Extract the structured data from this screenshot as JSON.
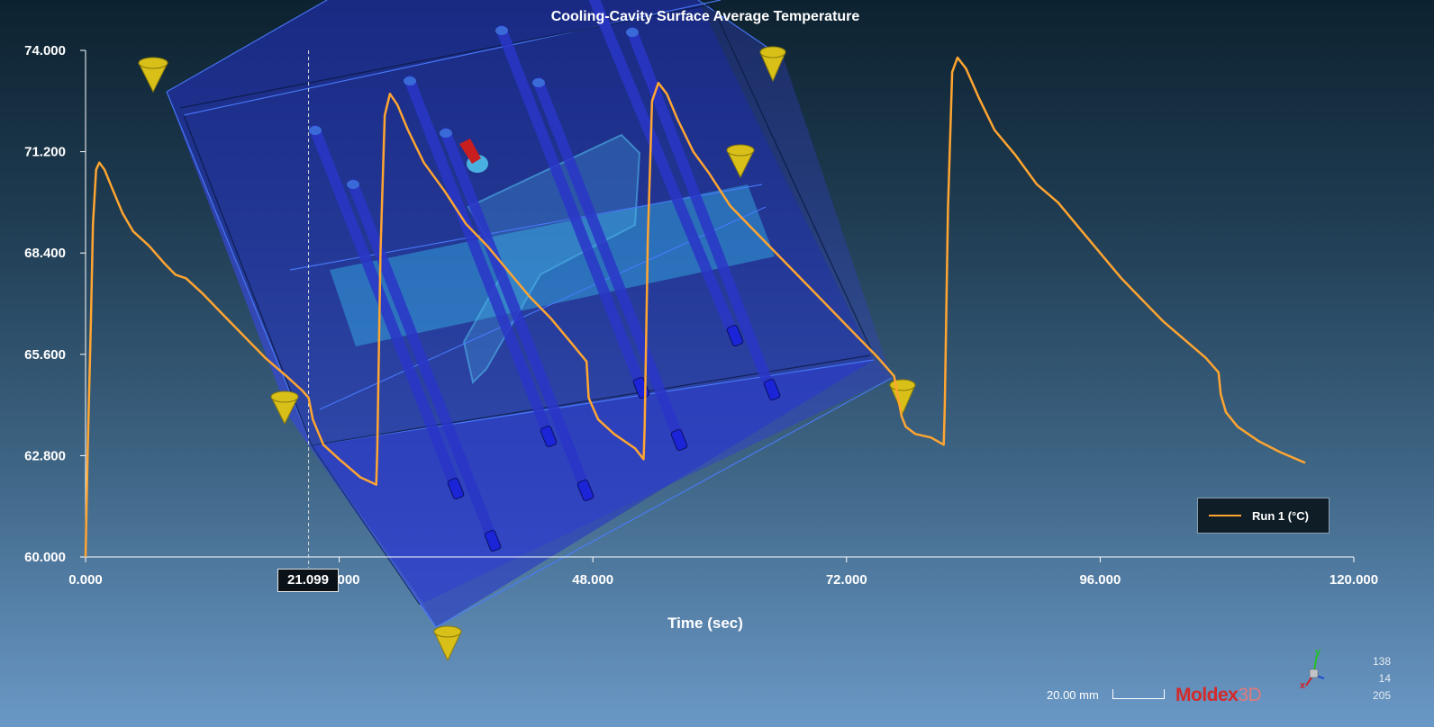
{
  "chart_data": {
    "type": "line",
    "title": "Cooling-Cavity Surface Average Temperature",
    "xlabel": "Time (sec)",
    "ylabel": "",
    "xlim": [
      0,
      120
    ],
    "ylim": [
      60,
      74
    ],
    "x_ticks": [
      "0.000",
      "24.000",
      "48.000",
      "72.000",
      "96.000",
      "120.000"
    ],
    "y_ticks": [
      "60.000",
      "62.800",
      "65.600",
      "68.400",
      "71.200",
      "74.000"
    ],
    "grid": false,
    "legend_position": "bottom-right",
    "series": [
      {
        "name": "Run 1 (°C)",
        "color": "#ffa531",
        "x": [
          0,
          0.2,
          0.5,
          0.7,
          1.0,
          1.3,
          1.8,
          2.5,
          3.5,
          4.5,
          6,
          7.5,
          8.5,
          9.5,
          11,
          13,
          15,
          17,
          19,
          20.5,
          21.1,
          21.5,
          22.5,
          24,
          26,
          27.5,
          27.6,
          27.9,
          28.3,
          28.8,
          29.5,
          30.5,
          32,
          34,
          36,
          38,
          40,
          42,
          44,
          46,
          47.4,
          47.6,
          48.5,
          50,
          52,
          52.8,
          52.9,
          53.2,
          53.6,
          54.2,
          55,
          56,
          57.5,
          59,
          61,
          63,
          65,
          67,
          69,
          71,
          73,
          75,
          76.5,
          77.2,
          77.6,
          78.5,
          80,
          81.2,
          81.3,
          81.6,
          82.0,
          82.5,
          83.3,
          84.5,
          86,
          88,
          90,
          92,
          94,
          96,
          98,
          100,
          102,
          104,
          106,
          107.2,
          107.4,
          107.9,
          109,
          111,
          113,
          115.4
        ],
        "y": [
          60.0,
          62.9,
          66.5,
          69.2,
          70.7,
          70.9,
          70.7,
          70.2,
          69.5,
          69.0,
          68.6,
          68.1,
          67.8,
          67.7,
          67.3,
          66.7,
          66.1,
          65.5,
          65.0,
          64.6,
          64.4,
          63.8,
          63.1,
          62.7,
          62.2,
          62.0,
          62.9,
          68.4,
          72.2,
          72.8,
          72.5,
          71.8,
          70.9,
          70.1,
          69.2,
          68.6,
          67.9,
          67.2,
          66.6,
          65.9,
          65.4,
          64.4,
          63.8,
          63.4,
          63.0,
          62.7,
          63.6,
          68.8,
          72.6,
          73.1,
          72.8,
          72.1,
          71.2,
          70.6,
          69.7,
          69.1,
          68.5,
          67.9,
          67.3,
          66.7,
          66.1,
          65.5,
          65.0,
          63.9,
          63.6,
          63.4,
          63.3,
          63.1,
          64.2,
          69.6,
          73.4,
          73.8,
          73.5,
          72.7,
          71.8,
          71.1,
          70.3,
          69.8,
          69.1,
          68.4,
          67.7,
          67.1,
          66.5,
          66.0,
          65.5,
          65.1,
          64.5,
          64.0,
          63.6,
          63.2,
          62.9,
          62.6
        ]
      }
    ]
  },
  "cursor": {
    "label": "21.099",
    "x": 21.099
  },
  "scale": {
    "label": "20.00 mm"
  },
  "brand": {
    "part1": "Moldex",
    "part2": "3D"
  },
  "coords": [
    "138",
    "14",
    "205"
  ],
  "triad": {
    "x": "x",
    "y": "y"
  },
  "colors": {
    "mold_fill": "#2f3fd0",
    "insert_fill": "#35b6e6",
    "runner_pipe": "#2a36c8",
    "gate_marker": "#1b24d6",
    "cone_fill": "#d8c019",
    "inlet_marker": "#c81e1e",
    "line": "#ffa531"
  }
}
